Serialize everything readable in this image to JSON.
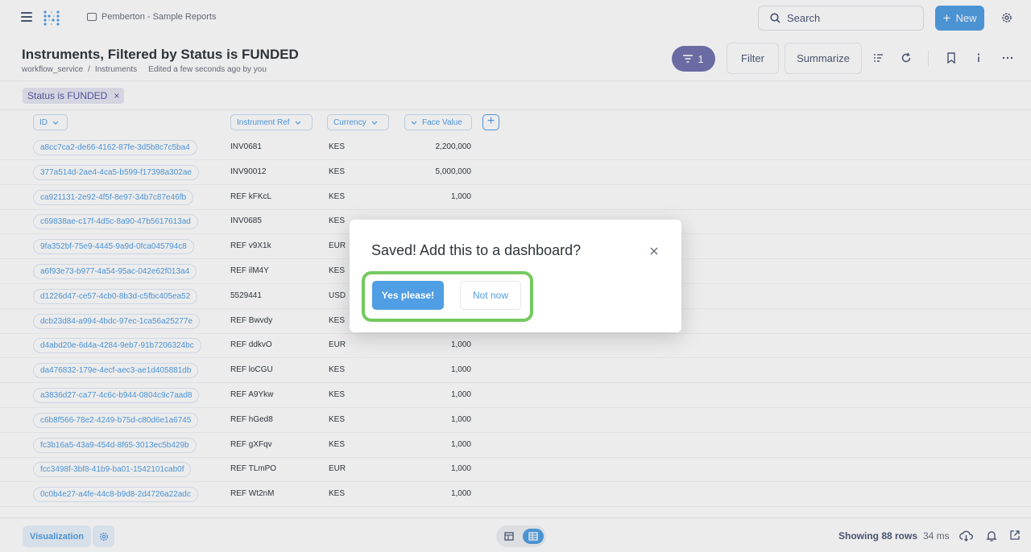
{
  "nav": {
    "collection": "Pemberton - Sample Reports",
    "search_label": "Search",
    "new_label": "New"
  },
  "header": {
    "title": "Instruments, Filtered by Status is FUNDED",
    "db": "workflow_service",
    "table": "Instruments",
    "separator": "/",
    "edited": "Edited a few seconds ago by you",
    "filter_count": "1",
    "filter_label": "Filter",
    "summarize_label": "Summarize"
  },
  "filter_chip": {
    "label": "Status is FUNDED",
    "remove": "×"
  },
  "columns": [
    "ID",
    "Instrument Ref",
    "Currency",
    "Face Value"
  ],
  "rows": [
    {
      "id": "a8cc7ca2-de66-4162-87fe-3d5b8c7c5ba4",
      "ref": "INV0681",
      "currency": "KES",
      "value": "2,200,000"
    },
    {
      "id": "377a514d-2ae4-4ca5-b599-f17398a302ae",
      "ref": "INV90012",
      "currency": "KES",
      "value": "5,000,000"
    },
    {
      "id": "ca921131-2e92-4f5f-8e97-34b7c87e46fb",
      "ref": "REF kFKcL",
      "currency": "KES",
      "value": "1,000"
    },
    {
      "id": "c69838ae-c17f-4d5c-8a90-47b5617613ad",
      "ref": "INV0685",
      "currency": "KES",
      "value": ""
    },
    {
      "id": "9fa352bf-75e9-4445-9a9d-0fca045794c8",
      "ref": "REF v9X1k",
      "currency": "EUR",
      "value": ""
    },
    {
      "id": "a6f93e73-b977-4a54-95ac-042e62f013a4",
      "ref": "REF ilM4Y",
      "currency": "KES",
      "value": ""
    },
    {
      "id": "d1226d47-ce57-4cb0-8b3d-c5fbc405ea52",
      "ref": "5529441",
      "currency": "USD",
      "value": ""
    },
    {
      "id": "dcb23d84-a994-4bdc-97ec-1ca56a25277e",
      "ref": "REF Bwvdy",
      "currency": "KES",
      "value": ""
    },
    {
      "id": "d4abd20e-6d4a-4284-9eb7-91b7206324bc",
      "ref": "REF ddkvO",
      "currency": "EUR",
      "value": "1,000"
    },
    {
      "id": "da476832-179e-4ecf-aec3-ae1d405881db",
      "ref": "REF loCGU",
      "currency": "KES",
      "value": "1,000"
    },
    {
      "id": "a3836d27-ca77-4c6c-b944-0804c9c7aad8",
      "ref": "REF A9Ykw",
      "currency": "KES",
      "value": "1,000"
    },
    {
      "id": "c6b8f566-78e2-4249-b75d-c80d6e1a6745",
      "ref": "REF hGed8",
      "currency": "KES",
      "value": "1,000"
    },
    {
      "id": "fc3b16a5-43a9-454d-8f65-3013ec5b429b",
      "ref": "REF gXFqv",
      "currency": "KES",
      "value": "1,000"
    },
    {
      "id": "fcc3498f-3bf8-41b9-ba01-1542101cab0f",
      "ref": "REF TLmPO",
      "currency": "EUR",
      "value": "1,000"
    },
    {
      "id": "0c0b4e27-a4fe-44c8-b9d8-2d4726a22adc",
      "ref": "REF Wt2nM",
      "currency": "KES",
      "value": "1,000"
    }
  ],
  "footer": {
    "visualization_label": "Visualization",
    "rows_label": "Showing 88 rows",
    "time_label": "34 ms"
  },
  "modal": {
    "title": "Saved! Add this to a dashboard?",
    "yes_label": "Yes please!",
    "no_label": "Not now"
  },
  "colors": {
    "brand": "#509ee3",
    "filter": "#7172ad",
    "highlight": "#74c95f"
  }
}
